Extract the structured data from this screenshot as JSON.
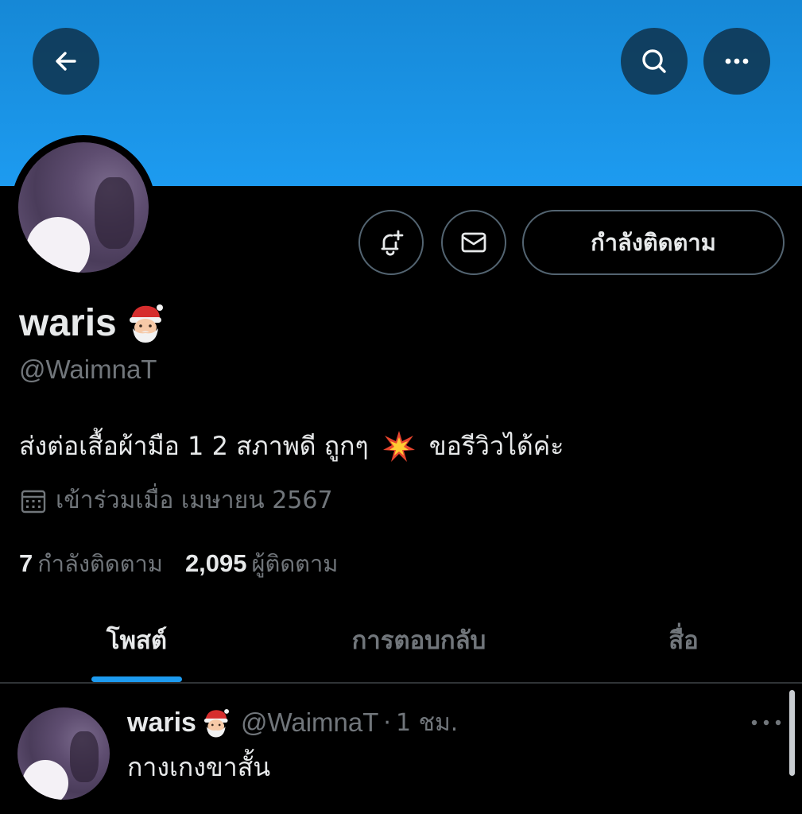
{
  "profile": {
    "display_name": "waris",
    "name_emoji": "santa-emoji",
    "handle": "@WaimnaT",
    "bio_part1": "ส่งต่อเสื้อผ้ามือ 1 2 สภาพดี ถูกๆ",
    "bio_emoji": "collision-emoji",
    "bio_part2": "ขอรีวิวได้ค่ะ",
    "joined": "เข้าร่วมเมื่อ เมษายน 2567",
    "following_count": "7",
    "following_label": "กำลังติดตาม",
    "followers_count": "2,095",
    "followers_label": "ผู้ติดตาม"
  },
  "header": {
    "banner_color": "#1d9bf0",
    "back_icon": "arrow-left-icon",
    "search_icon": "search-icon",
    "more_icon": "more-horizontal-icon"
  },
  "actions": {
    "notify_icon": "bell-plus-icon",
    "message_icon": "mail-icon",
    "following_button": "กำลังติดตาม"
  },
  "tabs": [
    {
      "label": "โพสต์",
      "active": true
    },
    {
      "label": "การตอบกลับ",
      "active": false
    },
    {
      "label": "สื่อ",
      "active": false
    }
  ],
  "post": {
    "name": "waris",
    "handle": "@WaimnaT",
    "separator": "·",
    "time": "1 ชม.",
    "text": "กางเกงขาสั้น"
  },
  "colors": {
    "accent": "#1d9bf0",
    "background": "#000000",
    "text_primary": "#e7e9ea",
    "text_secondary": "#71767b",
    "border": "#536471"
  }
}
